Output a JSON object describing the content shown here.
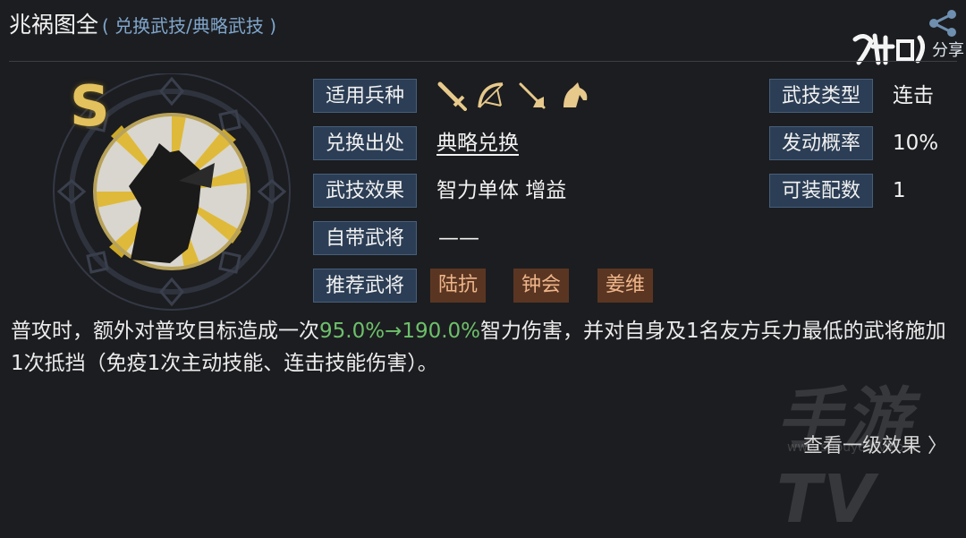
{
  "header": {
    "title": "兆祸图全",
    "subtitle": "( 兑换武技/典略武技 )",
    "share_text": "分享"
  },
  "skill": {
    "grade": "S",
    "troops": [
      "sword-icon",
      "bow-icon",
      "spear-icon",
      "horse-icon"
    ],
    "fields": {
      "troop_label": "适用兵种",
      "source_label": "兑换出处",
      "source_value": "典略兑换",
      "effect_label": "武技效果",
      "effect_value": "智力单体 增益",
      "own_general_label": "自带武将",
      "own_general_value": "——",
      "recommend_label": "推荐武将",
      "type_label": "武技类型",
      "type_value": "连击",
      "rate_label": "发动概率",
      "rate_value": "10%",
      "equip_label": "可装配数",
      "equip_value": "1"
    },
    "recommended": [
      "陆抗",
      "钟会",
      "姜维"
    ]
  },
  "description": {
    "part1": "普攻时，额外对普攻目标造成一次",
    "highlight": "95.0%→190.0%",
    "part2": "智力伤害，并对自身及1名友方兵力最低的武将施加1次抵挡（免疫1次主动技能、连击技能伤害）。"
  },
  "footer": {
    "more_label": "查看一级效果 〉"
  },
  "watermark": {
    "text": "手游TV",
    "url": "www.shouyoutv.com"
  },
  "colors": {
    "accent_label_bg": "#2c3e55",
    "highlight": "#6dc06b",
    "tag_bg": "#5a3622",
    "grade": "#e3c15d"
  }
}
